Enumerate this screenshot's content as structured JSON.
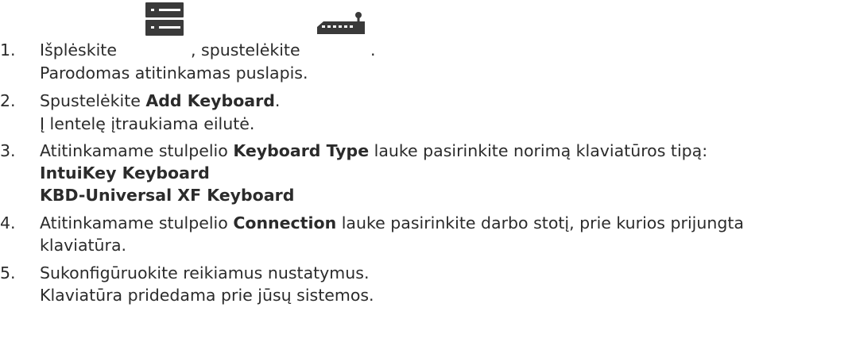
{
  "steps": [
    {
      "number": "1.",
      "text_before": "Išplėskite",
      "icon1": "server-list-icon",
      "text_mid": ", spustelėkite",
      "icon2": "keyboard-joystick-icon",
      "text_after": ".",
      "result": "Parodomas atitinkamas puslapis."
    },
    {
      "number": "2.",
      "text_before": "Spustelėkite ",
      "bold": "Add Keyboard",
      "text_after": ".",
      "result": "Į lentelę įtraukiama eilutė."
    },
    {
      "number": "3.",
      "text_before": "Atitinkamame stulpelio ",
      "bold": "Keyboard Type",
      "text_after": " lauke pasirinkite norimą klaviatūros tipą:",
      "options": [
        "IntuiKey Keyboard",
        "KBD-Universal XF Keyboard"
      ]
    },
    {
      "number": "4.",
      "text_before": "Atitinkamame stulpelio ",
      "bold": "Connection",
      "text_after": " lauke pasirinkite darbo stotį, prie kurios prijungta",
      "continuation": "klaviatūra."
    },
    {
      "number": "5.",
      "text": "Sukonfigūruokite reikiamus nustatymus.",
      "result": "Klaviatūra pridedama prie jūsų sistemos."
    }
  ]
}
